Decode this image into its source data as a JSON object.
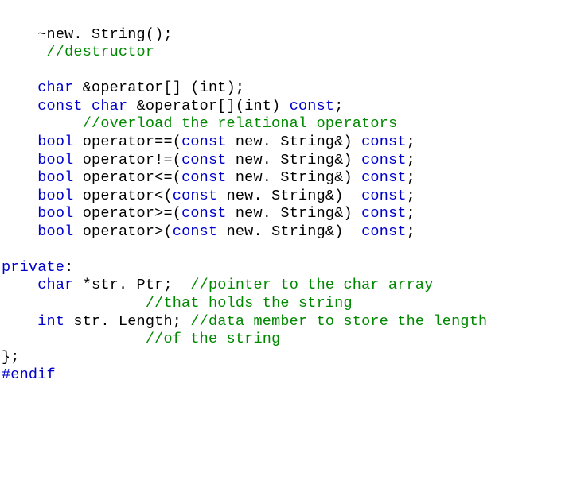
{
  "lines": {
    "0": {
      "pre": "    ",
      "text": "~new. String();"
    },
    "1": {
      "pre": "     ",
      "text": "//destructor"
    },
    "2": {
      "text": ""
    },
    "3": {
      "pre": "    ",
      "kw": "char",
      "text": " &operator[] (int);"
    },
    "4": {
      "pre": "    ",
      "kw1": "const",
      "mid1": " ",
      "kw2": "char",
      "mid2": " &operator[](int) ",
      "kw3": "const",
      "text": ";"
    },
    "5": {
      "pre": "         ",
      "text": "//overload the relational operators"
    },
    "6": {
      "pre": "    ",
      "kw1": "bool",
      "mid1": " operator==(",
      "kw2": "const",
      "mid2": " new. String&) ",
      "kw3": "const",
      "text": ";"
    },
    "7": {
      "pre": "    ",
      "kw1": "bool",
      "mid1": " operator!=(",
      "kw2": "const",
      "mid2": " new. String&) ",
      "kw3": "const",
      "text": ";"
    },
    "8": {
      "pre": "    ",
      "kw1": "bool",
      "mid1": " operator<=(",
      "kw2": "const",
      "mid2": " new. String&) ",
      "kw3": "const",
      "text": ";"
    },
    "9": {
      "pre": "    ",
      "kw1": "bool",
      "mid1": " operator<(",
      "kw2": "const",
      "mid2": " new. String&)  ",
      "kw3": "const",
      "text": ";"
    },
    "10": {
      "pre": "    ",
      "kw1": "bool",
      "mid1": " operator>=(",
      "kw2": "const",
      "mid2": " new. String&) ",
      "kw3": "const",
      "text": ";"
    },
    "11": {
      "pre": "    ",
      "kw1": "bool",
      "mid1": " operator>(",
      "kw2": "const",
      "mid2": " new. String&)  ",
      "kw3": "const",
      "text": ";"
    },
    "12": {
      "text": ""
    },
    "13": {
      "kw": "private",
      "text": ":"
    },
    "14": {
      "pre": "    ",
      "kw": "char",
      "mid": " *str. Ptr;  ",
      "cm": "//pointer to the char array"
    },
    "15": {
      "pre": "                ",
      "cm": "//that holds the string"
    },
    "16": {
      "pre": "    ",
      "kw": "int",
      "mid": " str. Length; ",
      "cm": "//data member to store the length"
    },
    "17": {
      "pre": "                ",
      "cm": "//of the string"
    },
    "18": {
      "text": "};"
    },
    "19": {
      "text": "#endif"
    }
  }
}
